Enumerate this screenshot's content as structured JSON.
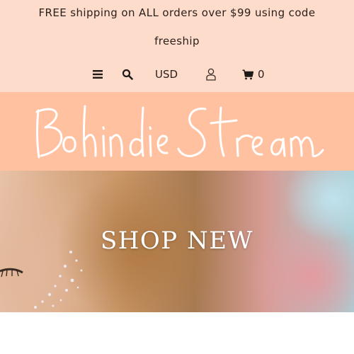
{
  "promo": {
    "line1": "FREE shipping on ALL orders over $99 using code",
    "line2": "freeship"
  },
  "nav": {
    "menu_icon": "hamburger-menu-icon",
    "search_icon": "search-icon",
    "currency": "USD",
    "account_icon": "user-icon",
    "cart_icon": "cart-icon",
    "cart_count": "0"
  },
  "logo": {
    "text": "Bohindie Stream"
  },
  "hero": {
    "title": "SHOP NEW"
  },
  "colors": {
    "topbar_bg": "#fddccb",
    "logo_band_bg": "#ffc1a0",
    "text": "#2a1f1b",
    "hero_text": "#ffffff"
  }
}
